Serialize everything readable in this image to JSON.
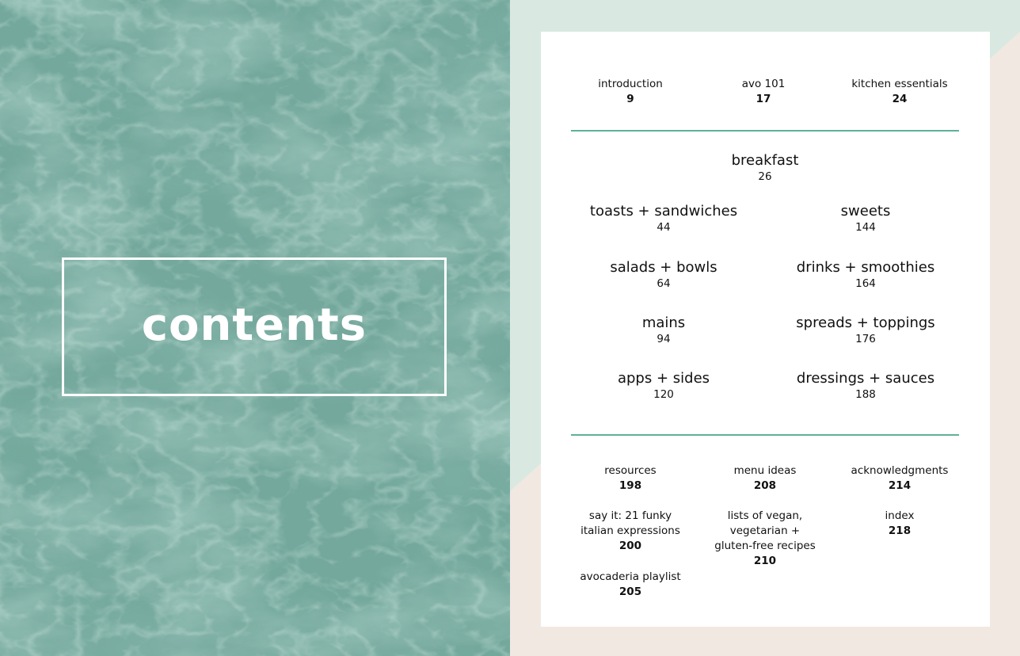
{
  "title": "contents",
  "colors": {
    "marble": "#74a89c",
    "mint": "#d9e9e2",
    "blush": "#f1e8e2",
    "rule": "#5fb198",
    "card": "#ffffff"
  },
  "top_entries": [
    {
      "label": "introduction",
      "page": "9"
    },
    {
      "label": "avo 101",
      "page": "17"
    },
    {
      "label": "kitchen essentials",
      "page": "24"
    }
  ],
  "breakfast": {
    "label": "breakfast",
    "page": "26"
  },
  "chapters_left": [
    {
      "label": "toasts + sandwiches",
      "page": "44"
    },
    {
      "label": "salads + bowls",
      "page": "64"
    },
    {
      "label": "mains",
      "page": "94"
    },
    {
      "label": "apps + sides",
      "page": "120"
    }
  ],
  "chapters_right": [
    {
      "label": "sweets",
      "page": "144"
    },
    {
      "label": "drinks + smoothies",
      "page": "164"
    },
    {
      "label": "spreads + toppings",
      "page": "176"
    },
    {
      "label": "dressings + sauces",
      "page": "188"
    }
  ],
  "back_matter": {
    "col1": [
      {
        "label": "resources",
        "page": "198"
      },
      {
        "label_lines": [
          "say it: 21 funky",
          "italian expressions"
        ],
        "page": "200"
      },
      {
        "label": "avocaderia playlist",
        "page": "205"
      }
    ],
    "col2": [
      {
        "label": "menu ideas",
        "page": "208"
      },
      {
        "label_lines": [
          "lists of vegan,",
          "vegetarian +",
          "gluten-free recipes"
        ],
        "page": "210"
      }
    ],
    "col3": [
      {
        "label": "acknowledgments",
        "page": "214"
      },
      {
        "label": "index",
        "page": "218"
      }
    ]
  }
}
